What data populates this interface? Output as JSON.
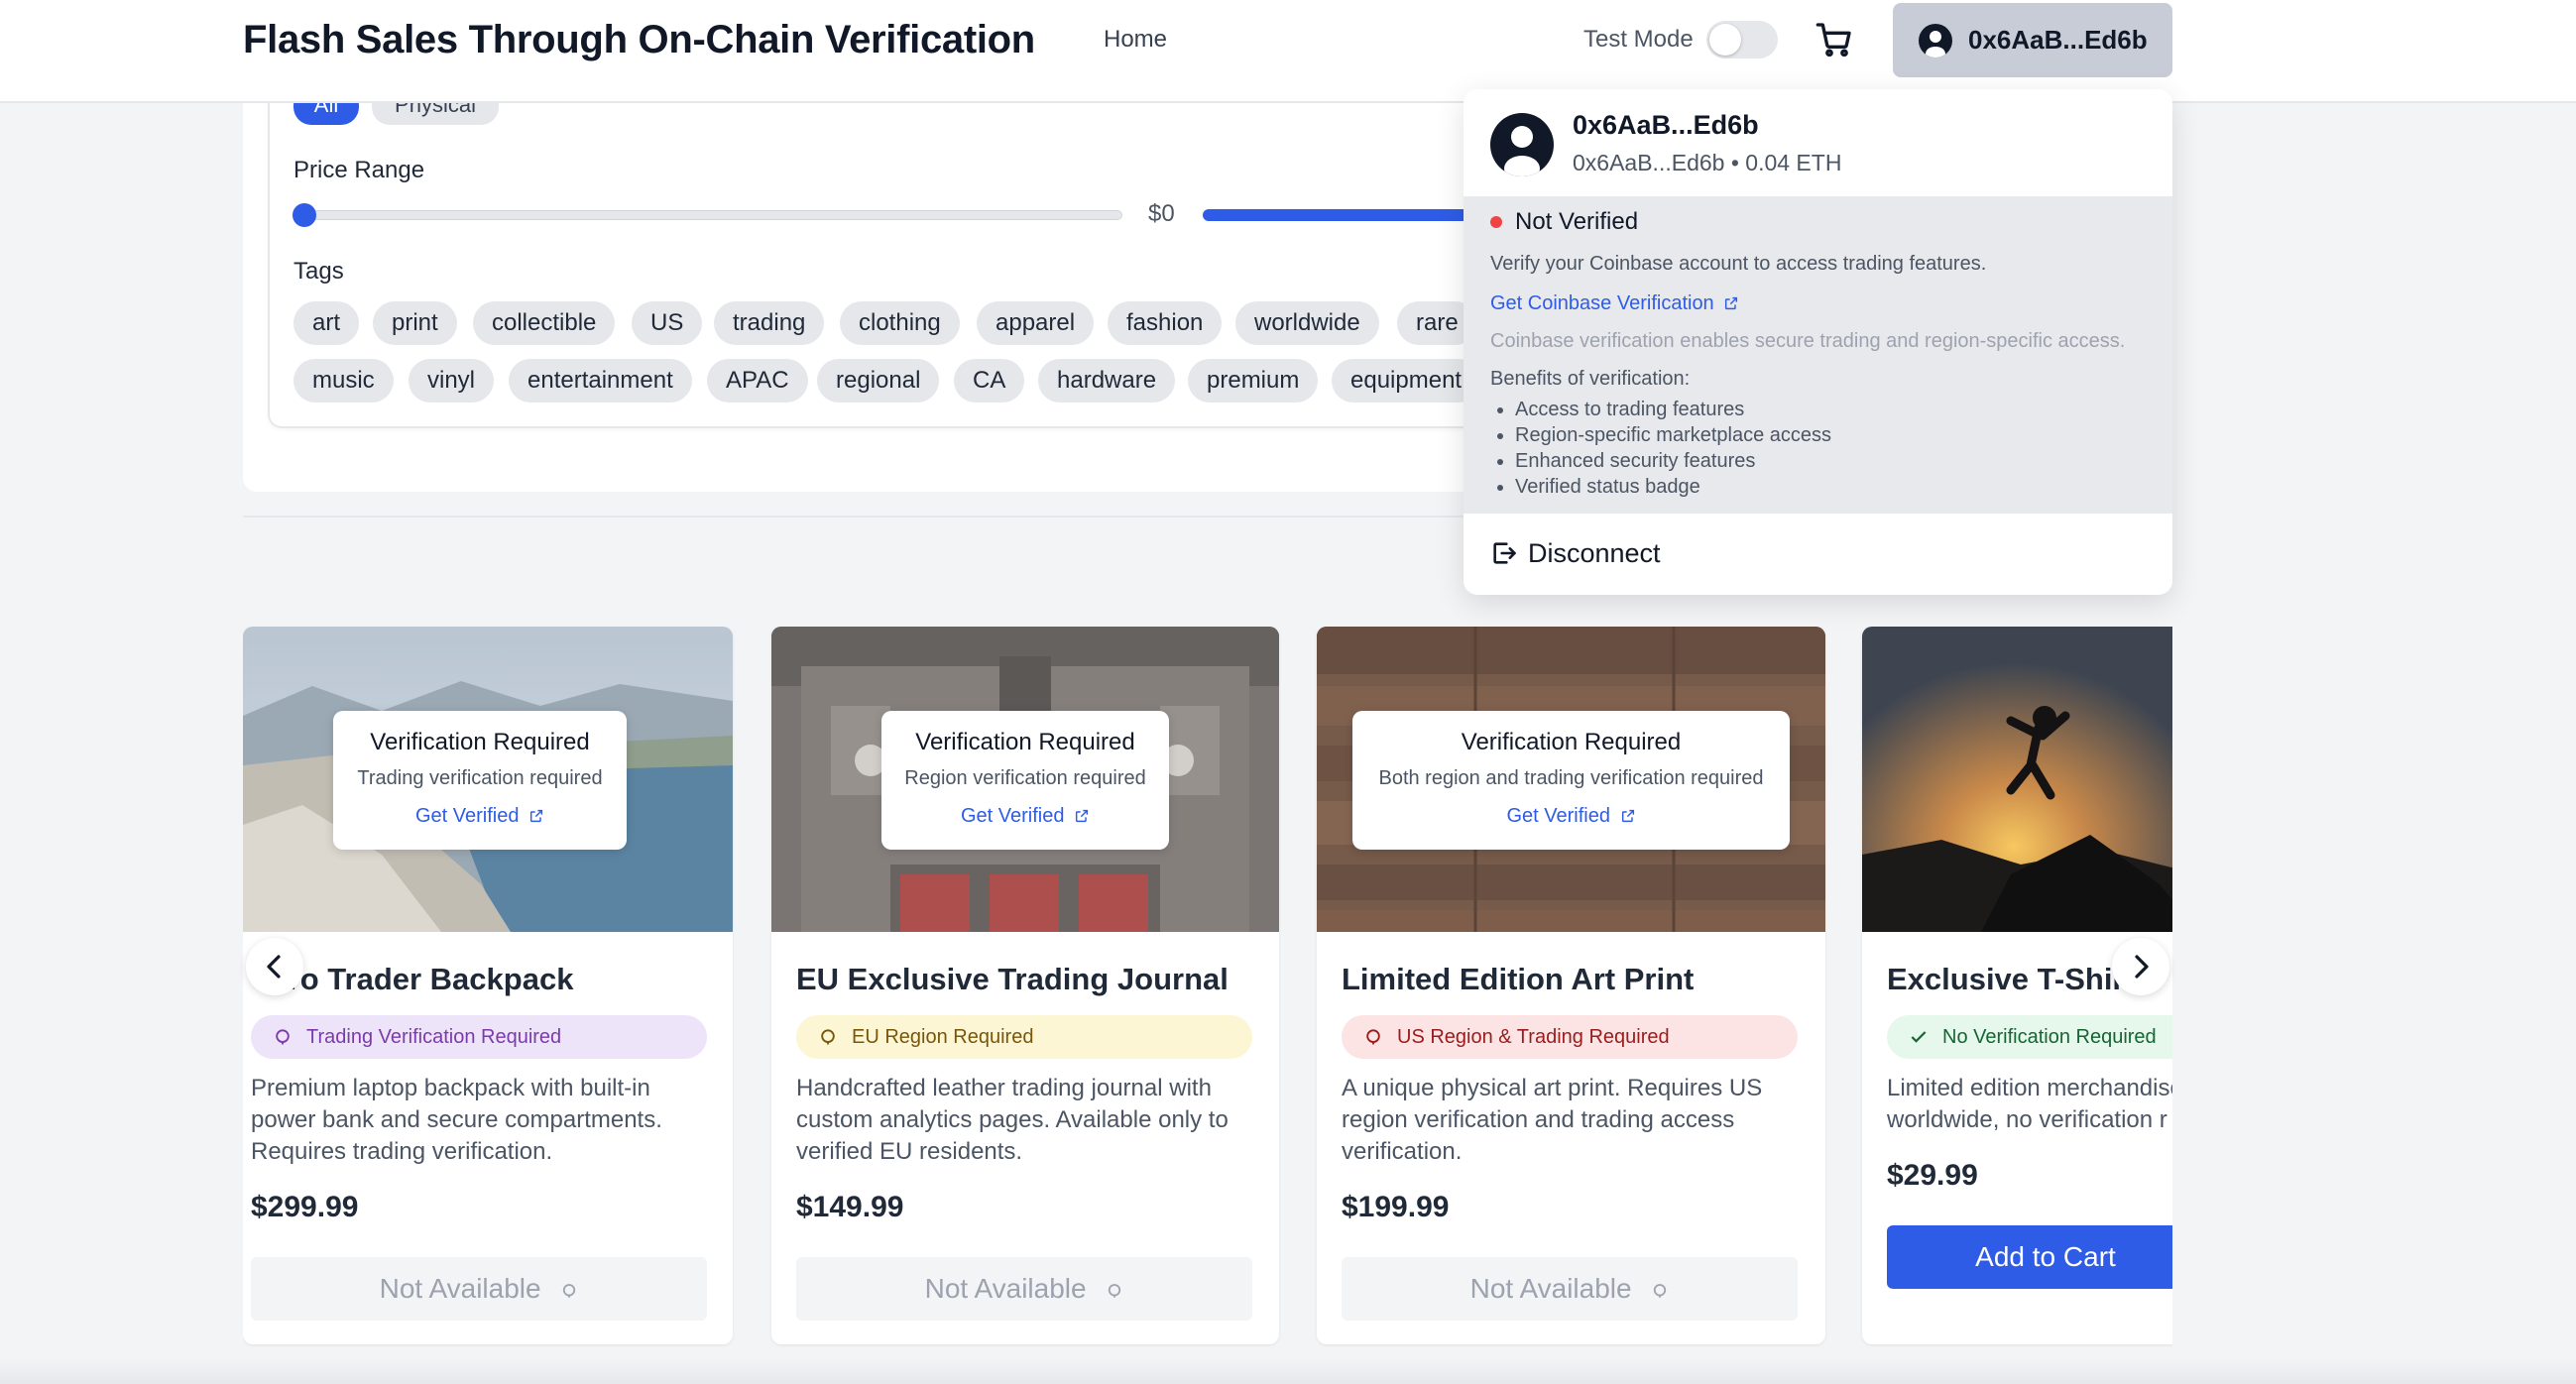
{
  "header": {
    "app_title": "Flash Sales Through On-Chain Verification",
    "nav_home": "Home",
    "test_mode_label": "Test Mode",
    "test_mode_on": false,
    "wallet_label": "0x6AaB...Ed6b"
  },
  "filters": {
    "categories": [
      {
        "label": "All",
        "active": true
      },
      {
        "label": "Physical",
        "active": false
      }
    ],
    "price_range_label": "Price Range",
    "price_min": "$0",
    "tags_label": "Tags",
    "tags_row1": [
      "art",
      "print",
      "collectible",
      "US",
      "trading",
      "clothing",
      "apparel",
      "fashion",
      "worldwide",
      "rare"
    ],
    "tags_row2": [
      "music",
      "vinyl",
      "entertainment",
      "APAC",
      "regional",
      "CA",
      "hardware",
      "premium",
      "equipment"
    ]
  },
  "products": [
    {
      "title": "Pro Trader Backpack",
      "badge": "Trading Verification Required",
      "description": "Premium laptop backpack with built-in power bank and secure compartments. Requires trading verification.",
      "price": "$299.99",
      "overlay_title": "Verification Required",
      "overlay_sub": "Trading verification required",
      "overlay_link": "Get Verified",
      "button": "Not Available"
    },
    {
      "title": "EU Exclusive Trading Journal",
      "badge": "EU Region Required",
      "description": "Handcrafted leather trading journal with custom analytics pages. Available only to verified EU residents.",
      "price": "$149.99",
      "overlay_title": "Verification Required",
      "overlay_sub": "Region verification required",
      "overlay_link": "Get Verified",
      "button": "Not Available"
    },
    {
      "title": "Limited Edition Art Print",
      "badge": "US Region & Trading Required",
      "description": "A unique physical art print. Requires US region verification and trading access verification.",
      "price": "$199.99",
      "overlay_title": "Verification Required",
      "overlay_sub": "Both region and trading verification required",
      "overlay_link": "Get Verified",
      "button": "Not Available"
    },
    {
      "title": "Exclusive T-Shirt",
      "badge": "No Verification Required",
      "description": "Limited edition merchandise worldwide, no verification r",
      "price": "$29.99",
      "button": "Add to Cart"
    }
  ],
  "wallet_dropdown": {
    "name": "0x6AaB...Ed6b",
    "sub": "0x6AaB...Ed6b • 0.04 ETH",
    "status": "Not Verified",
    "verify_text": "Verify your Coinbase account to access trading features.",
    "link": "Get Coinbase Verification",
    "note": "Coinbase verification enables secure trading and region-specific access.",
    "benefits_title": "Benefits of verification:",
    "benefits": [
      "Access to trading features",
      "Region-specific marketplace access",
      "Enhanced security features",
      "Verified status badge"
    ],
    "disconnect": "Disconnect"
  },
  "colors": {
    "accent": "#2e5ce6",
    "purple_badge_bg": "#ede4f9",
    "purple_badge_fg": "#7c3aad",
    "yellow_badge_bg": "#fdf6d5",
    "yellow_badge_fg": "#78560a",
    "red_badge_bg": "#fce4e4",
    "red_badge_fg": "#9b1c1c",
    "green_badge_bg": "#e6f7ec",
    "green_badge_fg": "#166534"
  }
}
